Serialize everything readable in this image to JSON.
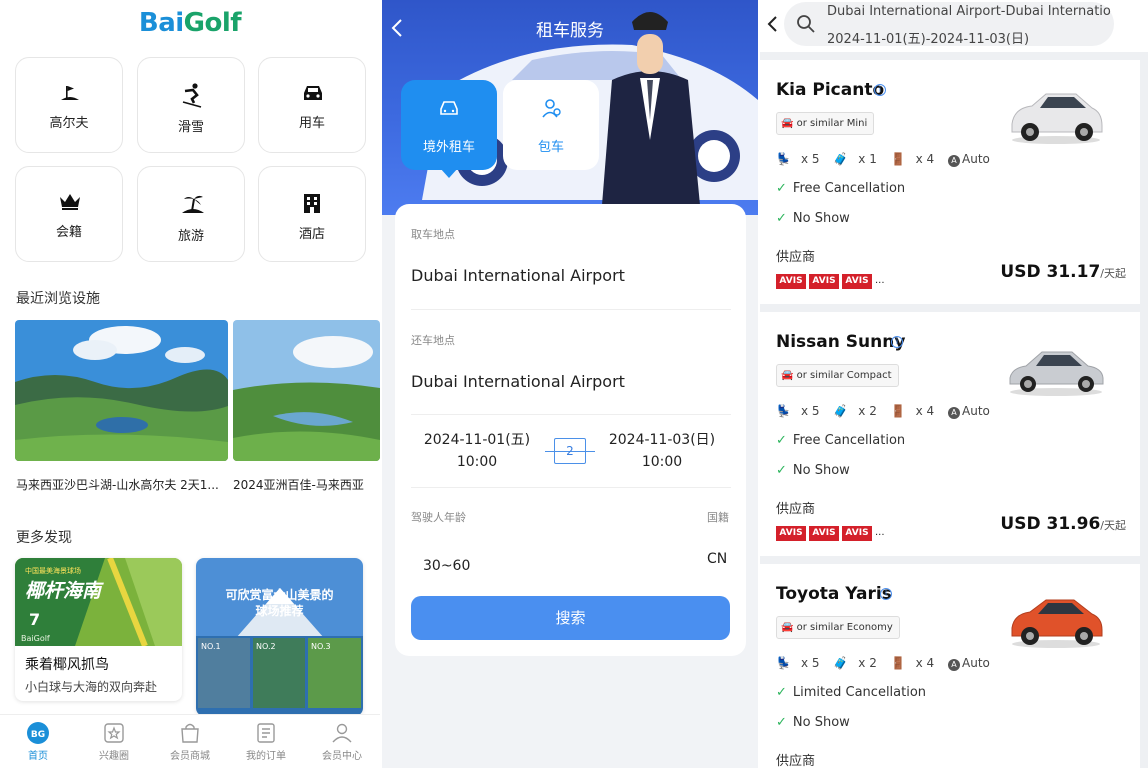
{
  "panel1": {
    "logo": "BaiGolf",
    "grid": [
      {
        "label": "高尔夫",
        "icon": "golf-icon"
      },
      {
        "label": "滑雪",
        "icon": "ski-icon"
      },
      {
        "label": "用车",
        "icon": "car-icon"
      },
      {
        "label": "会籍",
        "icon": "crown-icon"
      },
      {
        "label": "旅游",
        "icon": "island-icon"
      },
      {
        "label": "酒店",
        "icon": "hotel-icon"
      }
    ],
    "recent_title": "最近浏览设施",
    "recent": [
      {
        "caption": "马来西亚沙巴斗湖-山水高尔夫 2天1..."
      },
      {
        "caption": "2024亚洲百佳-马来西亚"
      }
    ],
    "discover_title": "更多发现",
    "discover": [
      {
        "image_text": "椰杆海南",
        "image_badge": "中国最美海景球场",
        "image_num": "7",
        "image_logo": "BaiGolf",
        "title": "乘着椰风抓鸟",
        "subtitle": "小白球与大海的双向奔赴"
      },
      {
        "image_text_1": "可欣赏富士山美景的",
        "image_text_2": "球场推荐",
        "no1": "NO.1",
        "no2": "NO.2",
        "no3": "NO.3"
      }
    ],
    "tabs": [
      {
        "label": "首页",
        "icon": "home-icon"
      },
      {
        "label": "兴趣圈",
        "icon": "star-icon"
      },
      {
        "label": "会员商城",
        "icon": "bag-icon"
      },
      {
        "label": "我的订单",
        "icon": "order-icon"
      },
      {
        "label": "会员中心",
        "icon": "user-icon"
      }
    ]
  },
  "panel2": {
    "title": "租车服务",
    "tile_rental": "境外租车",
    "tile_charter": "包车",
    "pickup_label": "取车地点",
    "pickup_value": "Dubai International Airport",
    "return_label": "还车地点",
    "return_value": "Dubai International Airport",
    "start_date": "2024-11-01(五)",
    "start_time": "10:00",
    "days": "2",
    "end_date": "2024-11-03(日)",
    "end_time": "10:00",
    "age_label": "驾驶人年龄",
    "age_value": "30~60",
    "nationality_label": "国籍",
    "nationality_value": "CN",
    "search_label": "搜索"
  },
  "panel3": {
    "header_line1": "Dubai International Airport-Dubai Internatio...",
    "header_line2": "2024-11-01(五)-2024-11-03(日)",
    "cars": [
      {
        "name": "Kia Picanto",
        "similar": "or similar  Mini",
        "seats": "x 5",
        "bags": "x 1",
        "doors": "x 4",
        "trans": "Auto",
        "feature1": "Free Cancellation",
        "feature2": "No Show",
        "supplier_label": "供应商",
        "supplier_logo": "AVIS",
        "more": "...",
        "price": "USD 31.17",
        "price_unit": "/天起",
        "color": "#e8e8ea"
      },
      {
        "name": "Nissan Sunny",
        "similar": "or similar  Compact",
        "seats": "x 5",
        "bags": "x 2",
        "doors": "x 4",
        "trans": "Auto",
        "feature1": "Free Cancellation",
        "feature2": "No Show",
        "supplier_label": "供应商",
        "supplier_logo": "AVIS",
        "more": "...",
        "price": "USD 31.96",
        "price_unit": "/天起",
        "color": "#c9ccd1"
      },
      {
        "name": "Toyota Yaris",
        "similar": "or similar  Economy",
        "seats": "x 5",
        "bags": "x 2",
        "doors": "x 4",
        "trans": "Auto",
        "feature1": "Limited Cancellation",
        "feature2": "No Show",
        "supplier_label": "供应商",
        "color": "#e0522a"
      }
    ],
    "trans_badge": "A"
  },
  "colors": {
    "brand_blue": "#4a8ff0",
    "brand_green": "#1aa36a",
    "avis_red": "#d4202a",
    "check_green": "#2db55d"
  }
}
